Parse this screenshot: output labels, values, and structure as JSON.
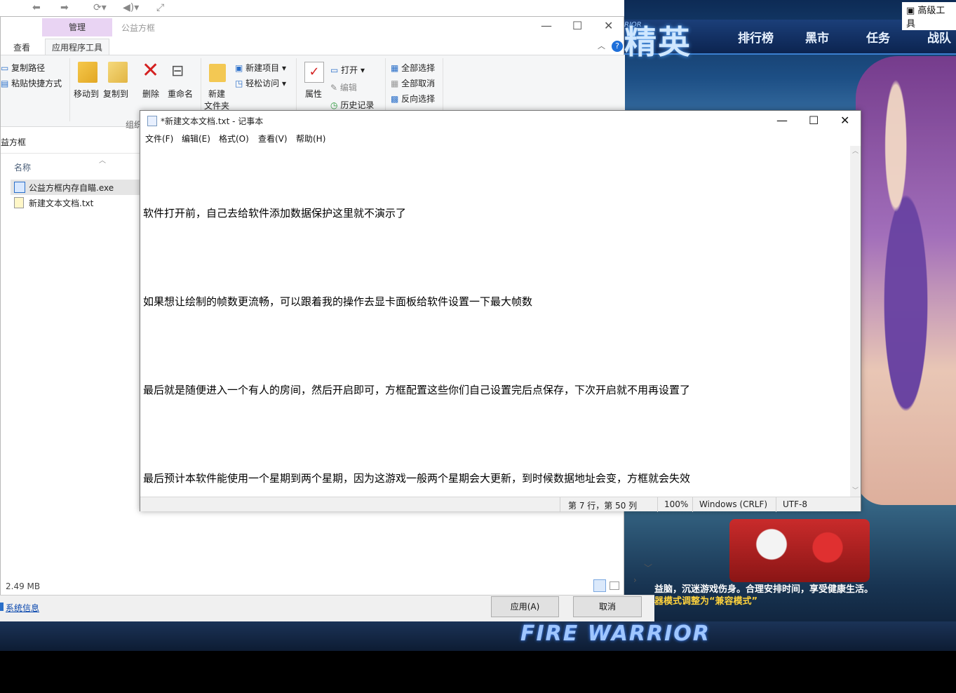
{
  "game": {
    "logo_small": "RIOR",
    "logo": "精英",
    "tabs": [
      "排行榜",
      "黑市",
      "任务",
      "战队"
    ],
    "topright_tool": "高级工具",
    "notice_line1": "益脑，沉迷游戏伤身。合理安排时间，享受健康生活。",
    "notice_line2": "器模式调整为“兼容模式”",
    "banner_title": "FIRE WARRIOR"
  },
  "explorer": {
    "context_tab": "管理",
    "window_title": "公益方框",
    "tabs": {
      "view": "查看",
      "app_tools": "应用程序工具"
    },
    "ribbon": {
      "copy_path": "复制路径",
      "paste_shortcut": "粘贴快捷方式",
      "move_to": "移动到",
      "copy_to": "复制到",
      "delete": "删除",
      "rename": "重命名",
      "new_folder_line1": "新建",
      "new_folder_line2": "文件夹",
      "new_item": "新建项目",
      "easy_access": "轻松访问",
      "properties": "属性",
      "open": "打开",
      "edit": "编辑",
      "history": "历史记录",
      "select_all": "全部选择",
      "select_none": "全部取消",
      "invert_selection": "反向选择",
      "group_organize": "组织"
    },
    "address": "益方框",
    "column_name": "名称",
    "files": [
      {
        "name": "公益方框内存自瞄.exe",
        "icon": "exe-icon"
      },
      {
        "name": "新建文本文档.txt",
        "icon": "txt-icon"
      }
    ],
    "size_status": "2.49 MB"
  },
  "notepad": {
    "title": "*新建文本文档.txt - 记事本",
    "menu": [
      "文件(F)",
      "编辑(E)",
      "格式(O)",
      "查看(V)",
      "帮助(H)"
    ],
    "lines": [
      "软件打开前，自己去给软件添加数据保护这里就不演示了",
      "如果想让绘制的帧数更流畅，可以跟着我的操作去显卡面板给软件设置一下最大帧数",
      "最后就是随便进入一个有人的房间，然后开启即可，方框配置这些你们自己设置完后点保存，下次开启就不用再设置了",
      "最后预计本软件能使用一个星期到两个星期，因为这游戏一般两个星期会大更新，到时候数据地址会变，方框就会失效"
    ],
    "status": {
      "position": "第 7 行，第 50 列",
      "zoom": "100%",
      "line_ending": "Windows (CRLF)",
      "encoding": "UTF-8"
    }
  },
  "dialog": {
    "system_info": "系统信息",
    "apply": "应用(A)",
    "cancel": "取消"
  }
}
